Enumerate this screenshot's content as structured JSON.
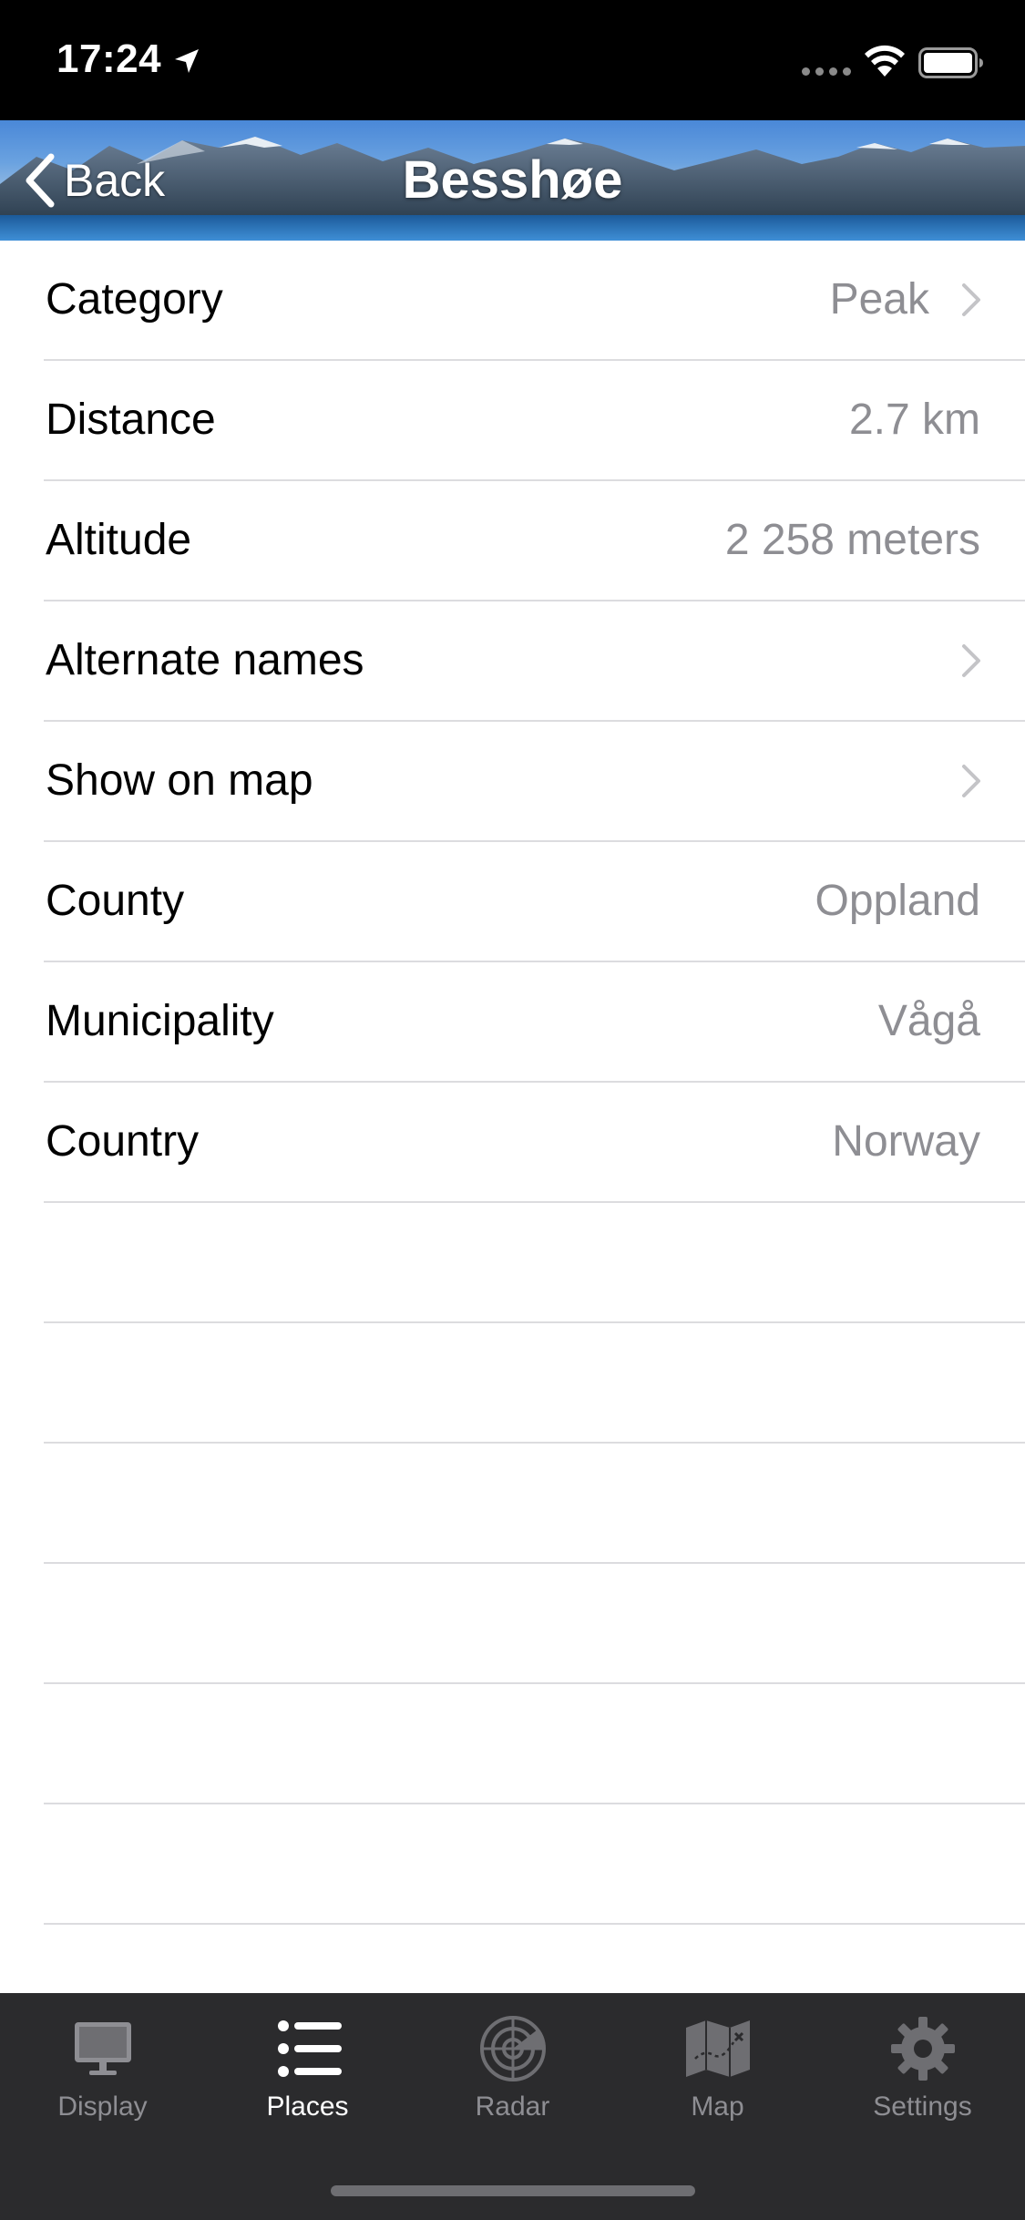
{
  "status_bar": {
    "time": "17:24"
  },
  "nav": {
    "back_label": "Back",
    "title": "Besshøe"
  },
  "rows": [
    {
      "label": "Category",
      "value": "Peak",
      "chevron": true
    },
    {
      "label": "Distance",
      "value": "2.7 km",
      "chevron": false
    },
    {
      "label": "Altitude",
      "value": "2 258 meters",
      "chevron": false
    },
    {
      "label": "Alternate names",
      "value": "",
      "chevron": true
    },
    {
      "label": "Show on map",
      "value": "",
      "chevron": true
    },
    {
      "label": "County",
      "value": "Oppland",
      "chevron": false
    },
    {
      "label": "Municipality",
      "value": "Vågå",
      "chevron": false
    },
    {
      "label": "Country",
      "value": "Norway",
      "chevron": false
    }
  ],
  "tabs": [
    {
      "label": "Display",
      "icon": "monitor-icon",
      "active": false
    },
    {
      "label": "Places",
      "icon": "list-icon",
      "active": true
    },
    {
      "label": "Radar",
      "icon": "radar-icon",
      "active": false
    },
    {
      "label": "Map",
      "icon": "map-icon",
      "active": false
    },
    {
      "label": "Settings",
      "icon": "gear-icon",
      "active": false
    }
  ],
  "colors": {
    "status_bar_bg": "#000000",
    "tab_bar_bg": "#2b2b2d",
    "secondary_text": "#8e8e93",
    "separator": "#dcdcdf",
    "active_tab": "#ffffff",
    "inactive_tab": "#8e8e93"
  }
}
